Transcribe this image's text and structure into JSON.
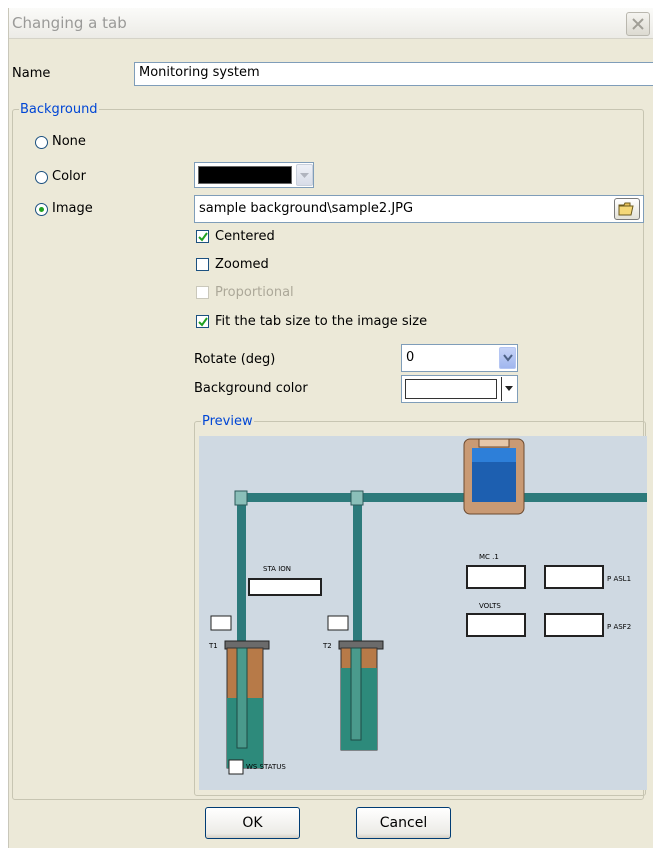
{
  "window": {
    "title": "Changing a tab"
  },
  "name_field": {
    "label": "Name",
    "value": "Monitoring system"
  },
  "background": {
    "legend": "Background",
    "options": [
      "None",
      "Color",
      "Image"
    ],
    "selected": "Image",
    "color_value": "#000000",
    "image_path": "sample background\\sample2.JPG"
  },
  "image_options": {
    "centered": {
      "label": "Centered",
      "checked": true
    },
    "zoomed": {
      "label": "Zoomed",
      "checked": false
    },
    "proportional": {
      "label": "Proportional",
      "checked": false,
      "disabled": true
    },
    "fit": {
      "label": "Fit the tab size to the image size",
      "checked": true
    },
    "rotate": {
      "label": "Rotate (deg)",
      "value": "0"
    },
    "bg_color": {
      "label": "Background color",
      "value": "#ffffff"
    }
  },
  "preview": {
    "legend": "Preview",
    "labels": {
      "station": "STA ION",
      "t1": "T1",
      "t2": "T2",
      "mc": "MC .1",
      "volts": "VOLTS",
      "phase1": "P ASL1",
      "phase2": "P ASF2",
      "status": "WS STATUS"
    }
  },
  "buttons": {
    "ok": "OK",
    "cancel": "Cancel"
  },
  "colors": {
    "legend": "#0046d5",
    "pipe": "#2d7a7b",
    "preview_bg": "#cfd9e2",
    "dialog_bg": "#ece9d8"
  }
}
